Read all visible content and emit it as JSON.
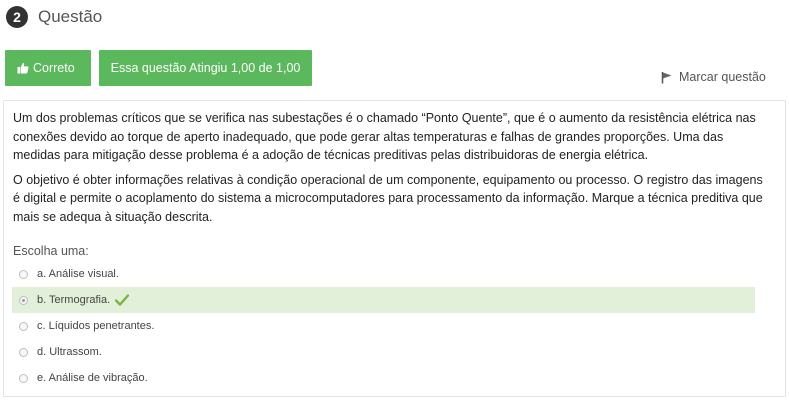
{
  "question": {
    "number": "2",
    "title": "Questão",
    "status_label": "Correto",
    "grade_label": "Essa questão Atingiu 1,00 de 1,00",
    "flag_label": "Marcar questão",
    "paragraphs": [
      "Um dos problemas críticos que se verifica nas subestações é o chamado “Ponto Quente”, que é o aumento da resistência elétrica nas conexões devido ao torque de aperto inadequado, que pode gerar altas temperaturas e falhas de grandes proporções. Uma das medidas para mitigação desse problema é a adoção de técnicas preditivas pelas distribuidoras de energia elétrica.",
      "O objetivo é obter informações relativas à condição operacional de um componente, equipamento ou processo. O registro das imagens é digital e permite o acoplamento do sistema a microcomputadores para processamento da informação. Marque a técnica preditiva que mais se adequa à situação descrita."
    ],
    "prompt": "Escolha uma:",
    "answers": [
      {
        "label": "a. Análise visual.",
        "selected": false,
        "correct": false
      },
      {
        "label": "b. Termografia.",
        "selected": true,
        "correct": true
      },
      {
        "label": "c. Líquidos penetrantes.",
        "selected": false,
        "correct": false
      },
      {
        "label": "d. Ultrassom.",
        "selected": false,
        "correct": false
      },
      {
        "label": "e. Análise de vibração.",
        "selected": false,
        "correct": false
      }
    ]
  },
  "colors": {
    "success": "#5cb85c",
    "correct_row": "#e2f0d9",
    "check": "#7cb342"
  },
  "icons": {
    "status": "thumbs-up-icon",
    "flag": "flag-icon",
    "correct": "check-icon"
  }
}
